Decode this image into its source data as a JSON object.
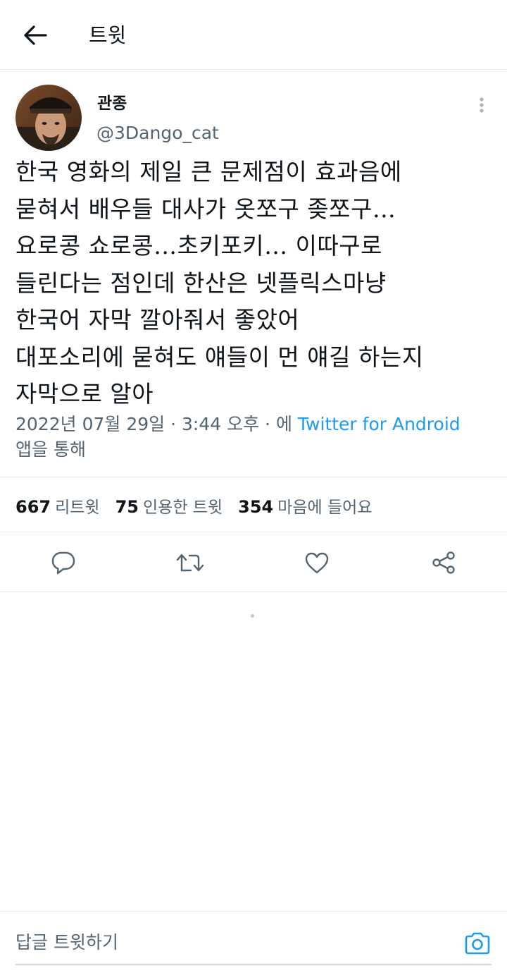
{
  "header": {
    "title": "트윗"
  },
  "tweet": {
    "display_name": "관종",
    "handle": "@3Dango_cat",
    "text": "한국 영화의 제일 큰 문제점이 효과음에\n묻혀서 배우들 대사가 옷쪼구 좆쪼구…\n요로콩 쇼로콩…초키포키… 이따구로\n들린다는 점인데 한산은 넷플릭스마냥\n한국어 자막 깔아줘서 좋았어\n대포소리에 묻혀도 얘들이 먼 얘길 하는지\n자막으로 알아",
    "date": "2022년 07월 29일",
    "time": "3:44 오후",
    "source_prefix": "에",
    "source": "Twitter for Android",
    "source_suffix": "앱을 통해"
  },
  "stats": {
    "retweets": "667",
    "retweets_label": "리트윗",
    "quotes": "75",
    "quotes_label": "인용한 트윗",
    "likes": "354",
    "likes_label": "마음에 들어요"
  },
  "reply": {
    "placeholder": "답글 트윗하기"
  },
  "icons": {
    "back": "arrow-left-icon",
    "more": "more-vertical-icon",
    "reply": "comment-icon",
    "retweet": "retweet-icon",
    "like": "heart-icon",
    "share": "share-icon",
    "camera": "camera-icon"
  },
  "colors": {
    "link": "#1d9bf0",
    "secondary_text": "#536471",
    "primary_text": "#0f1419",
    "divider": "#e6e6e6"
  }
}
